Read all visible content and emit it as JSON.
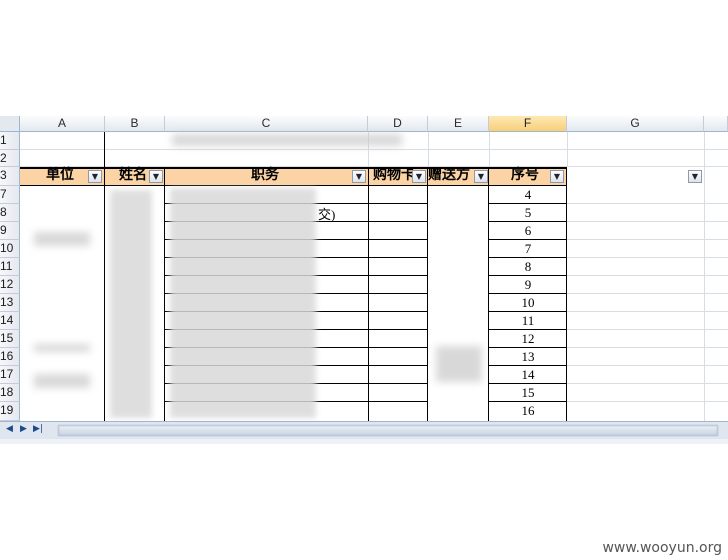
{
  "columns": [
    "A",
    "B",
    "C",
    "D",
    "E",
    "F",
    "G"
  ],
  "rows": [
    "1",
    "2",
    "3",
    "7",
    "8",
    "9",
    "10",
    "11",
    "12",
    "13",
    "14",
    "15",
    "16",
    "17",
    "18",
    "19"
  ],
  "header_row": {
    "unit": "单位",
    "name": "姓名",
    "position": "职务",
    "purchase": "购物卡",
    "gift": "赠送方",
    "seq": "序号"
  },
  "dropdown_glyph": "▼",
  "cell_fragment": "交)",
  "seq_values": [
    "4",
    "5",
    "6",
    "7",
    "8",
    "9",
    "10",
    "11",
    "12",
    "13",
    "14",
    "15",
    "16"
  ],
  "nav": {
    "first": "◀",
    "prev": "▶",
    "next": "▶|"
  },
  "watermark": "www.wooyun.org"
}
